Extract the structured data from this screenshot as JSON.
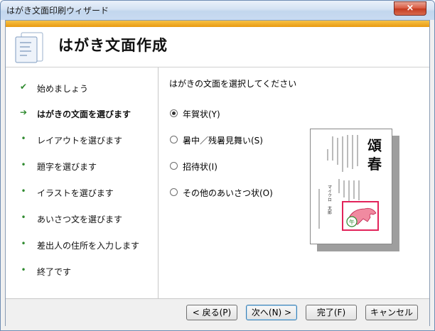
{
  "window": {
    "title": "はがき文面印刷ウィザード",
    "close_label": "×"
  },
  "header": {
    "title": "はがき文面作成"
  },
  "steps": [
    {
      "label": "始めましょう",
      "marker": "✔",
      "state": "done"
    },
    {
      "label": "はがきの文面を選びます",
      "marker": "➔",
      "state": "current"
    },
    {
      "label": "レイアウトを選びます",
      "marker": "•",
      "state": "todo"
    },
    {
      "label": "題字を選びます",
      "marker": "•",
      "state": "todo"
    },
    {
      "label": "イラストを選びます",
      "marker": "•",
      "state": "todo"
    },
    {
      "label": "あいさつ文を選びます",
      "marker": "•",
      "state": "todo"
    },
    {
      "label": "差出人の住所を入力します",
      "marker": "•",
      "state": "todo"
    },
    {
      "label": "終了です",
      "marker": "•",
      "state": "todo"
    }
  ],
  "content": {
    "prompt": "はがきの文面を選択してください",
    "options": [
      {
        "label": "年賀状(Y)",
        "checked": true
      },
      {
        "label": "暑中／残暑見舞い(S)",
        "checked": false
      },
      {
        "label": "招待状(I)",
        "checked": false
      },
      {
        "label": "その他のあいさつ状(O)",
        "checked": false
      }
    ],
    "preview": {
      "title_glyphs": "頌春",
      "sender_name": "マイクロ　太郎",
      "zodiac_glyph": "午",
      "accent_color": "#e2235a",
      "horse_color": "#f08aa0"
    }
  },
  "buttons": {
    "back": "< 戻る(P)",
    "next": "次へ(N) >",
    "finish": "完了(F)",
    "cancel": "キャンセル"
  }
}
